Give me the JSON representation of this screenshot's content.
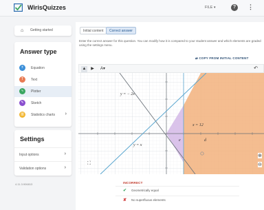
{
  "app": {
    "brand": "WirisQuizzes"
  },
  "topbar": {
    "file_label": "FILE",
    "help_symbol": "?",
    "more_symbol": "⋮"
  },
  "sidebar": {
    "getting_started": "Getting started",
    "answer_type": {
      "title": "Answer type",
      "items": [
        {
          "label": "Equation",
          "icon": "equation-icon",
          "color": "#3b8fd9"
        },
        {
          "label": "Text",
          "icon": "text-icon",
          "color": "#e87b54"
        },
        {
          "label": "Plotter",
          "icon": "plotter-icon",
          "color": "#3aa661",
          "selected": true
        },
        {
          "label": "Sketch",
          "icon": "sketch-icon",
          "color": "#8a4fcf"
        },
        {
          "label": "Statistics charts",
          "icon": "statistics-icon",
          "color": "#f2b632"
        }
      ]
    },
    "settings": {
      "title": "Settings",
      "items": [
        {
          "label": "Input options"
        },
        {
          "label": "Validation options"
        }
      ]
    },
    "version": "4.11.3.906813"
  },
  "main": {
    "tabs": [
      {
        "label": "Initial content"
      },
      {
        "label": "Correct answer",
        "active": true
      }
    ],
    "instructions": "Enter the correct answer for this question. You can modify how it is compared to your student answer and which elements are graded using the settings menu.",
    "copy_button": "COPY FROM INITIAL CONTENT",
    "toolbar": {
      "select": "▲",
      "point": "▶",
      "text_tool": "A",
      "undo": "↶"
    },
    "graph": {
      "labels": {
        "eq1": "y = − 2x",
        "eq2": "y = x",
        "eq3": "x = 12",
        "region_e": "e",
        "region_d": "d"
      },
      "colors": {
        "lavender": "#d4b8e6",
        "orange": "#f2b27d",
        "line": "#5aa6cf"
      },
      "controls": {
        "expand_symbol": "⛶",
        "zoom_in_symbol": "⊕",
        "zoom_out_symbol": "⊖"
      }
    },
    "feedback": {
      "status": "INCORRECT",
      "checks": [
        {
          "mark": "✔",
          "text": "Geometrically equal",
          "ok": true
        },
        {
          "mark": "✘",
          "text": "No superfluous elements",
          "ok": false
        }
      ]
    }
  }
}
